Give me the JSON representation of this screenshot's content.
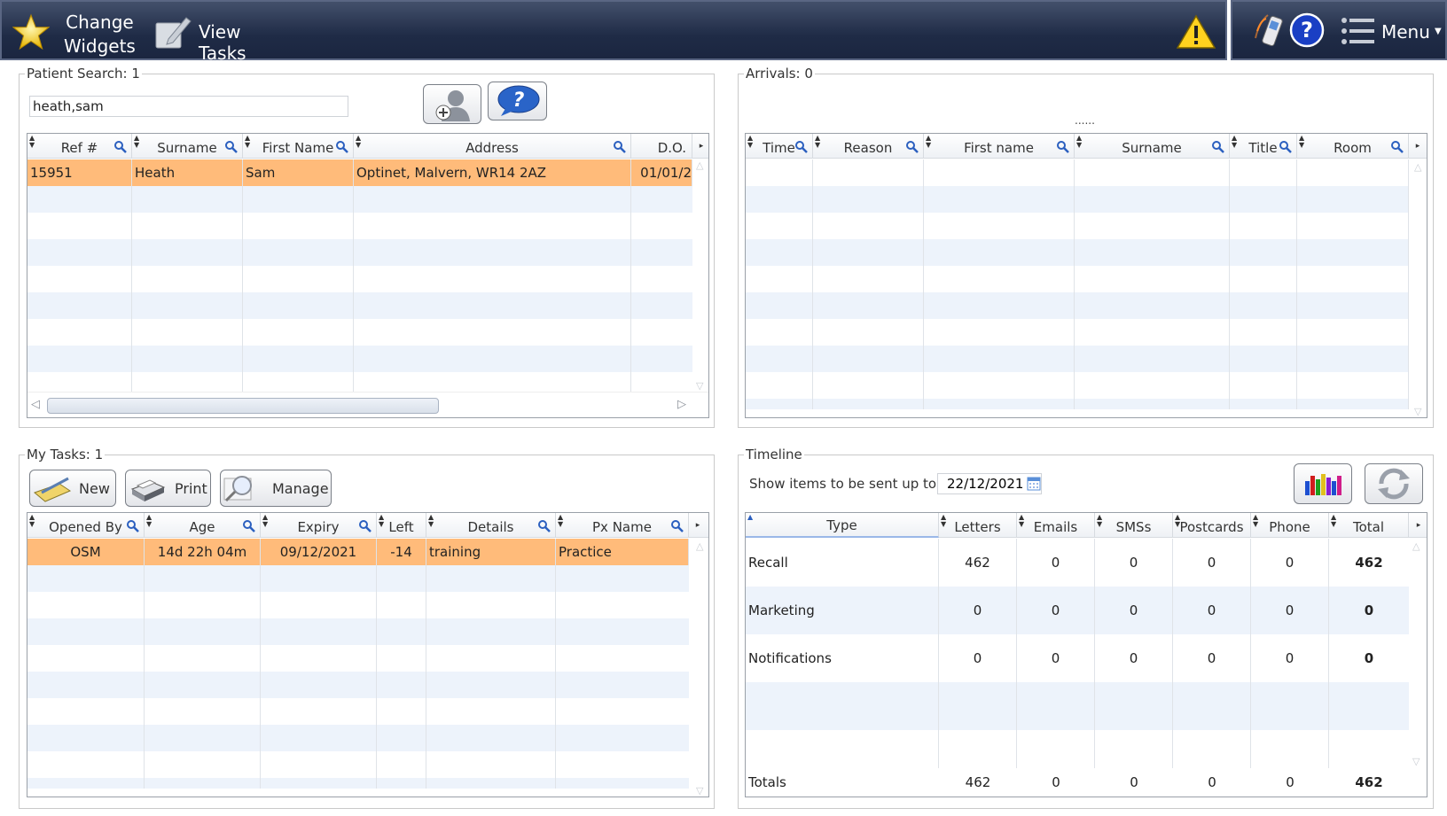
{
  "topbar": {
    "change_widgets_line1": "Change",
    "change_widgets_line2": "Widgets",
    "view_tasks": "View Tasks",
    "menu": "Menu"
  },
  "patient_search": {
    "title": "Patient Search: 1",
    "query": "heath,sam",
    "columns": [
      "Ref #",
      "Surname",
      "First Name",
      "Address",
      "D.O."
    ],
    "rows": [
      [
        "15951",
        "Heath",
        "Sam",
        "Optinet, Malvern, WR14 2AZ",
        "01/01/2"
      ]
    ]
  },
  "arrivals": {
    "title": "Arrivals: 0",
    "splitter": "......",
    "columns": [
      "Time",
      "Reason",
      "First name",
      "Surname",
      "Title",
      "Room"
    ]
  },
  "my_tasks": {
    "title": "My Tasks: 1",
    "buttons": {
      "new": "New",
      "print": "Print",
      "manage": "Manage"
    },
    "columns": [
      "Opened By",
      "Age",
      "Expiry",
      "Left",
      "Details",
      "Px Name"
    ],
    "rows": [
      [
        "OSM",
        "14d 22h 04m",
        "09/12/2021",
        "-14",
        "training",
        "Practice"
      ]
    ]
  },
  "timeline": {
    "title": "Timeline",
    "show_label": "Show items to be sent up to",
    "date": "22/12/2021",
    "columns": [
      "Type",
      "Letters",
      "Emails",
      "SMSs",
      "Postcards",
      "Phone",
      "Total"
    ],
    "rows": [
      [
        "Recall",
        "462",
        "0",
        "0",
        "0",
        "0",
        "462"
      ],
      [
        "Marketing",
        "0",
        "0",
        "0",
        "0",
        "0",
        "0"
      ],
      [
        "Notifications",
        "0",
        "0",
        "0",
        "0",
        "0",
        "0"
      ]
    ],
    "totals": [
      "Totals",
      "462",
      "0",
      "0",
      "0",
      "0",
      "462"
    ]
  },
  "colors": {
    "topbar": "#1f2b46",
    "selected_row": "#ffbb7a",
    "alt_row": "#edf3fb"
  }
}
